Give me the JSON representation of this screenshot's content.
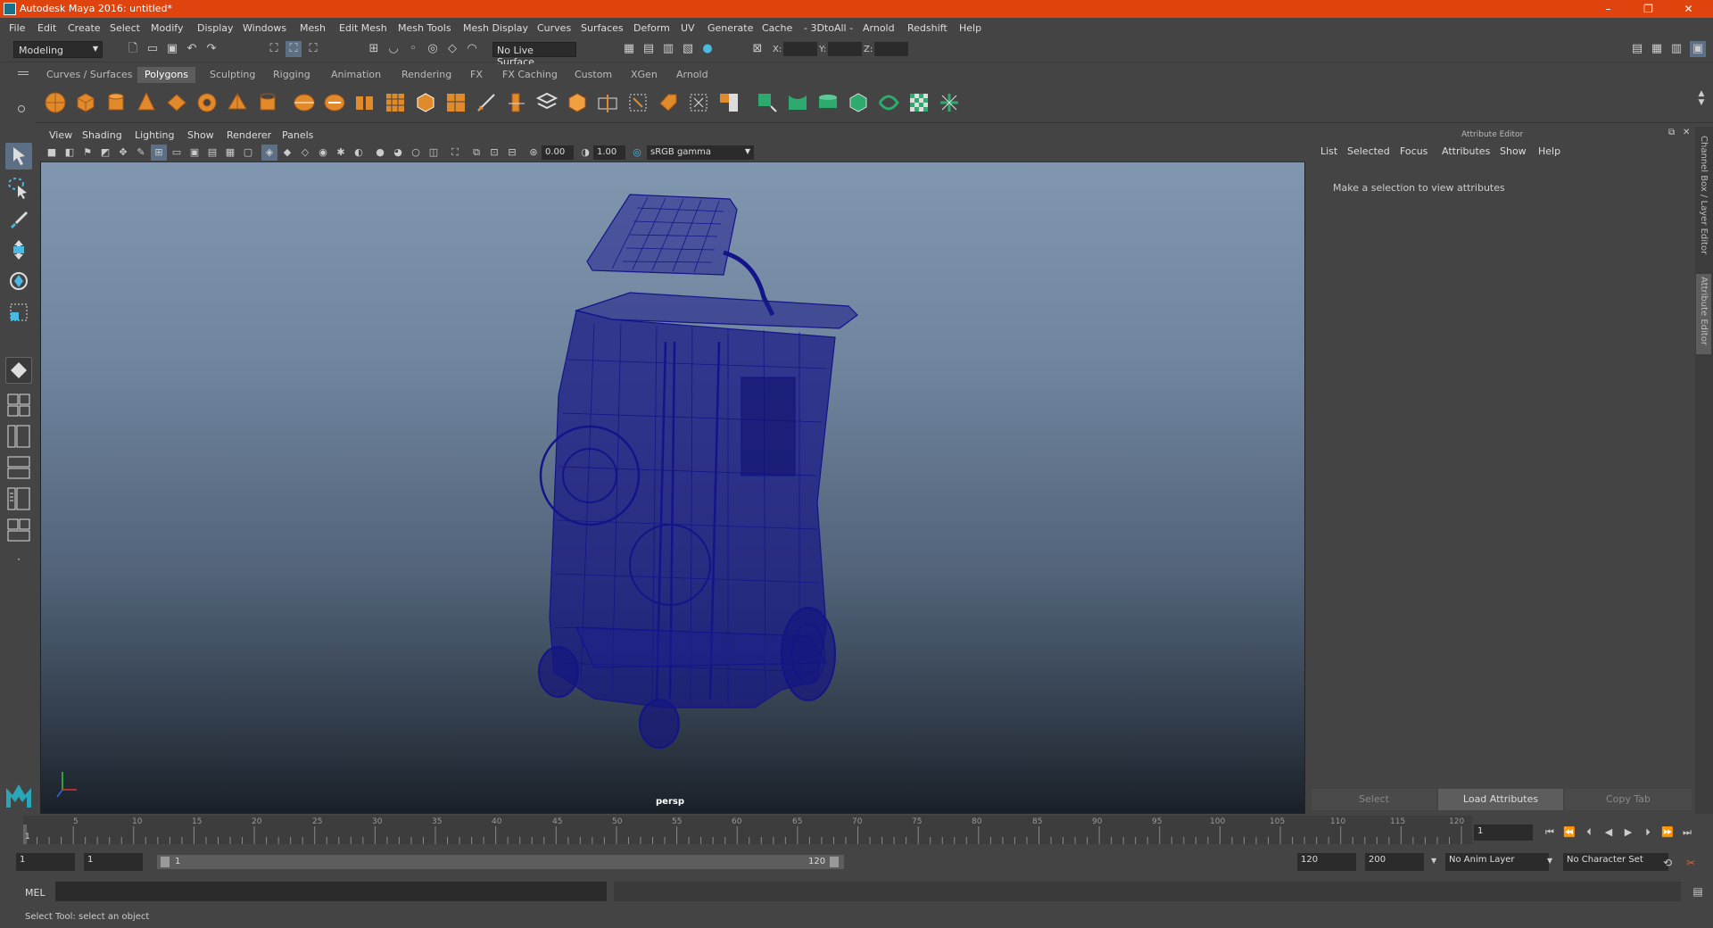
{
  "title": "Autodesk Maya 2016: untitled*",
  "window_controls": [
    "–",
    "❐",
    "✕"
  ],
  "menus": [
    "File",
    "Edit",
    "Create",
    "Select",
    "Modify",
    "Display",
    "Windows",
    "Mesh",
    "Edit Mesh",
    "Mesh Tools",
    "Mesh Display",
    "Curves",
    "Surfaces",
    "Deform",
    "UV",
    "Generate",
    "Cache",
    "- 3DtoAll -",
    "Arnold",
    "Redshift",
    "Help"
  ],
  "statusline": {
    "mode": "Modeling",
    "live_surface": "No Live Surface",
    "x_label": "X:",
    "y_label": "Y:",
    "z_label": "Z:"
  },
  "shelf_tabs": [
    "Curves / Surfaces",
    "Polygons",
    "Sculpting",
    "Rigging",
    "Animation",
    "Rendering",
    "FX",
    "FX Caching",
    "Custom",
    "XGen",
    "Arnold"
  ],
  "active_shelf_tab": "Polygons",
  "viewport": {
    "menus": [
      "View",
      "Shading",
      "Lighting",
      "Show",
      "Renderer",
      "Panels"
    ],
    "exposure": "0.00",
    "gamma": "1.00",
    "color_space": "sRGB gamma",
    "camera_label": "persp"
  },
  "attribute_editor": {
    "title": "Attribute Editor",
    "menus": [
      "List",
      "Selected",
      "Focus",
      "Attributes",
      "Show",
      "Help"
    ],
    "message": "Make a selection to view attributes",
    "buttons": {
      "select": "Select",
      "load": "Load Attributes",
      "copy": "Copy Tab"
    }
  },
  "side_tabs": [
    "Channel Box / Layer Editor",
    "Attribute Editor"
  ],
  "timeline": {
    "ticks": [
      "5",
      "10",
      "15",
      "20",
      "25",
      "30",
      "35",
      "40",
      "45",
      "50",
      "55",
      "60",
      "65",
      "70",
      "75",
      "80",
      "85",
      "90",
      "95",
      "100",
      "105",
      "110",
      "115",
      "120"
    ],
    "current_frame_marker": "1",
    "current_frame": "1"
  },
  "range": {
    "start": "1",
    "playback_start": "1",
    "slider_start": "1",
    "slider_end": "120",
    "playback_end": "120",
    "end": "200",
    "anim_layer": "No Anim Layer",
    "character_set": "No Character Set"
  },
  "command": {
    "label": "MEL"
  },
  "help_line": "Select Tool: select an object",
  "colors": {
    "titlebar": "#e0440e",
    "wireframe": "#14148a",
    "panel": "#444444"
  }
}
